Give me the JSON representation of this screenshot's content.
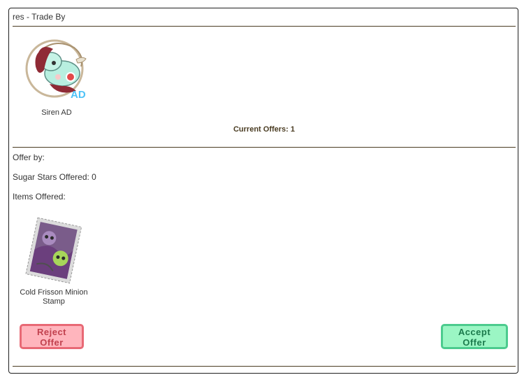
{
  "trade": {
    "title": "res - Trade By",
    "item": {
      "name": "Siren AD",
      "badge": "AD",
      "icon": "siren-mermaid-pet-image"
    },
    "current_offers": "Current Offers: 1"
  },
  "offer": {
    "offer_by": "Offer by:",
    "sugar_stars": "Sugar Stars Offered: 0",
    "items_label": "Items Offered:",
    "item": {
      "name": "Cold Frisson Minion Stamp",
      "icon": "stamp-image"
    }
  },
  "buttons": {
    "reject": "Reject Offer",
    "accept": "Accept Offer"
  },
  "colors": {
    "reject_bg": "#ffb5bd",
    "reject_border": "#e86975",
    "accept_bg": "#9bf6c4",
    "accept_border": "#4ccb8e",
    "rule": "#4a3c22"
  }
}
